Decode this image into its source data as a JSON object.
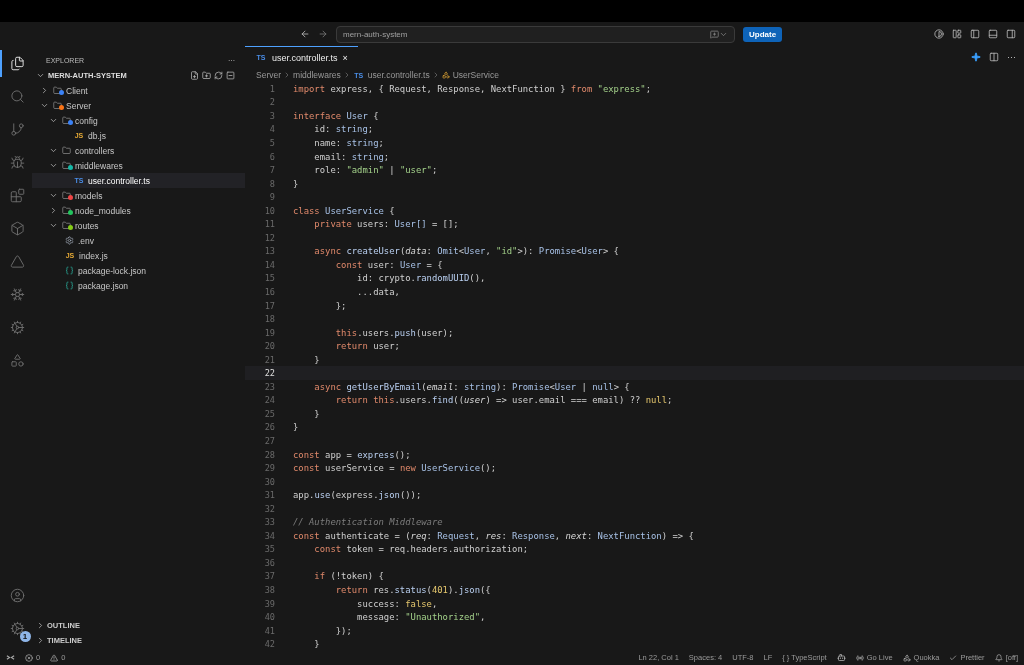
{
  "titlebar": {
    "search": {
      "value": "mern-auth-system"
    },
    "update_button": "Update"
  },
  "activity_bar": {
    "items": [
      {
        "kind": "files",
        "selected": true
      },
      {
        "kind": "search",
        "selected": false
      },
      {
        "kind": "git",
        "selected": false
      },
      {
        "kind": "debug",
        "selected": false
      },
      {
        "kind": "extensions",
        "selected": false
      },
      {
        "kind": "box",
        "selected": false
      },
      {
        "kind": "triangle",
        "selected": false
      },
      {
        "kind": "snowflake",
        "selected": false
      },
      {
        "kind": "cog",
        "selected": false
      },
      {
        "kind": "delta",
        "selected": false
      }
    ],
    "settings_badge": "1"
  },
  "sidebar": {
    "title": "EXPLORER",
    "more": "···",
    "root": {
      "label": "MERN-AUTH-SYSTEM",
      "expanded": true
    },
    "tree": [
      {
        "label": "Client",
        "kind": "folder",
        "color": "#3b82f6",
        "expanded": false,
        "selected": false
      },
      {
        "label": "Server",
        "kind": "folder",
        "color": "#f97316",
        "expanded": true,
        "selected": false,
        "children": [
          {
            "label": "config",
            "kind": "folder",
            "color": "#3b82f6",
            "expanded": true,
            "selected": false,
            "children": [
              {
                "label": "db.js",
                "kind": "js",
                "badge": "JS",
                "selected": false
              }
            ]
          },
          {
            "label": "controllers",
            "kind": "folder",
            "expanded": true,
            "selected": false
          },
          {
            "label": "middlewares",
            "kind": "folder",
            "color": "#14b8a6",
            "expanded": true,
            "selected": false,
            "children": [
              {
                "label": "user.controller.ts",
                "kind": "ts",
                "badge": "TS",
                "selected": true
              }
            ]
          },
          {
            "label": "models",
            "kind": "folder",
            "color": "#ef4444",
            "expanded": true,
            "selected": false
          },
          {
            "label": "node_modules",
            "kind": "folder",
            "color": "#22c55e",
            "expanded": false,
            "selected": false
          },
          {
            "label": "routes",
            "kind": "folder",
            "color": "#84cc16",
            "expanded": true,
            "selected": false
          },
          {
            "label": ".env",
            "kind": "env",
            "selected": false
          },
          {
            "label": "index.js",
            "kind": "js",
            "badge": "JS",
            "selected": false
          },
          {
            "label": "package-lock.json",
            "kind": "json",
            "selected": false
          },
          {
            "label": "package.json",
            "kind": "json",
            "selected": false
          }
        ]
      }
    ],
    "panels": [
      {
        "label": "OUTLINE",
        "expanded": false
      },
      {
        "label": "TIMELINE",
        "expanded": false
      }
    ]
  },
  "editor": {
    "tabs": [
      {
        "label": "user.controller.ts",
        "badge": "TS",
        "close": "×",
        "selected": true
      }
    ],
    "tab_more": "···",
    "breadcrumbs": [
      {
        "label": "Server",
        "kind": "folder"
      },
      {
        "label": "middlewares",
        "kind": "folder"
      },
      {
        "label": "user.controller.ts",
        "kind": "ts",
        "badge": "TS"
      },
      {
        "label": "UserService",
        "kind": "class"
      }
    ],
    "lines": [
      {
        "number": "1",
        "current": false,
        "tokens": [
          {
            "text": "import",
            "kind": "kw"
          },
          {
            "text": " express, { Request, Response, NextFunction } ",
            "kind": "pl"
          },
          {
            "text": "from",
            "kind": "kw"
          },
          {
            "text": " \"express\"",
            "kind": "st"
          },
          {
            "text": ";",
            "kind": "pl"
          }
        ]
      },
      {
        "number": "2",
        "current": false
      },
      {
        "number": "3",
        "current": false,
        "tokens": [
          {
            "text": "interface",
            "kind": "kw"
          },
          {
            "text": " User",
            "kind": "ty"
          },
          {
            "text": " {",
            "kind": "pl"
          }
        ]
      },
      {
        "number": "4",
        "current": false,
        "tokens": [
          {
            "text": "    id: ",
            "kind": "pl"
          },
          {
            "text": "string",
            "kind": "ty"
          },
          {
            "text": ";",
            "kind": "pl"
          }
        ]
      },
      {
        "number": "5",
        "current": false,
        "tokens": [
          {
            "text": "    name: ",
            "kind": "pl"
          },
          {
            "text": "string",
            "kind": "ty"
          },
          {
            "text": ";",
            "kind": "pl"
          }
        ]
      },
      {
        "number": "6",
        "current": false,
        "tokens": [
          {
            "text": "    email: ",
            "kind": "pl"
          },
          {
            "text": "string",
            "kind": "ty"
          },
          {
            "text": ";",
            "kind": "pl"
          }
        ]
      },
      {
        "number": "7",
        "current": false,
        "tokens": [
          {
            "text": "    role: ",
            "kind": "pl"
          },
          {
            "text": "\"admin\"",
            "kind": "st"
          },
          {
            "text": " | ",
            "kind": "pl"
          },
          {
            "text": "\"user\"",
            "kind": "st"
          },
          {
            "text": ";",
            "kind": "pl"
          }
        ]
      },
      {
        "number": "8",
        "current": false,
        "tokens": [
          {
            "text": "}",
            "kind": "pl"
          }
        ]
      },
      {
        "number": "9",
        "current": false
      },
      {
        "number": "10",
        "current": false,
        "tokens": [
          {
            "text": "class",
            "kind": "kw"
          },
          {
            "text": " UserService",
            "kind": "ty"
          },
          {
            "text": " {",
            "kind": "pl"
          }
        ]
      },
      {
        "number": "11",
        "current": false,
        "tokens": [
          {
            "text": "    private",
            "kind": "kw"
          },
          {
            "text": " users: ",
            "kind": "pl"
          },
          {
            "text": "User[]",
            "kind": "ty"
          },
          {
            "text": " = [];",
            "kind": "pl"
          }
        ]
      },
      {
        "number": "12",
        "current": false
      },
      {
        "number": "13",
        "current": false,
        "tokens": [
          {
            "text": "    async",
            "kind": "kw"
          },
          {
            "text": " createUser",
            "kind": "fn"
          },
          {
            "text": "(",
            "kind": "pl"
          },
          {
            "text": "data",
            "kind": "pa"
          },
          {
            "text": ": ",
            "kind": "pl"
          },
          {
            "text": "Omit",
            "kind": "ty"
          },
          {
            "text": "<",
            "kind": "pl"
          },
          {
            "text": "User",
            "kind": "ty"
          },
          {
            "text": ", ",
            "kind": "pl"
          },
          {
            "text": "\"id\"",
            "kind": "st"
          },
          {
            "text": ">): ",
            "kind": "pl"
          },
          {
            "text": "Promise",
            "kind": "ty"
          },
          {
            "text": "<",
            "kind": "pl"
          },
          {
            "text": "User",
            "kind": "ty"
          },
          {
            "text": "> {",
            "kind": "pl"
          }
        ]
      },
      {
        "number": "14",
        "current": false,
        "tokens": [
          {
            "text": "        const",
            "kind": "kw"
          },
          {
            "text": " user: ",
            "kind": "pl"
          },
          {
            "text": "User",
            "kind": "ty"
          },
          {
            "text": " = {",
            "kind": "pl"
          }
        ]
      },
      {
        "number": "15",
        "current": false,
        "tokens": [
          {
            "text": "            id: crypto.",
            "kind": "pl"
          },
          {
            "text": "randomUUID",
            "kind": "fn"
          },
          {
            "text": "(),",
            "kind": "pl"
          }
        ]
      },
      {
        "number": "16",
        "current": false,
        "tokens": [
          {
            "text": "            ...data,",
            "kind": "pl"
          }
        ]
      },
      {
        "number": "17",
        "current": false,
        "tokens": [
          {
            "text": "        };",
            "kind": "pl"
          }
        ]
      },
      {
        "number": "18",
        "current": false
      },
      {
        "number": "19",
        "current": false,
        "tokens": [
          {
            "text": "        this",
            "kind": "kw"
          },
          {
            "text": ".users.",
            "kind": "pl"
          },
          {
            "text": "push",
            "kind": "fn"
          },
          {
            "text": "(user);",
            "kind": "pl"
          }
        ]
      },
      {
        "number": "20",
        "current": false,
        "tokens": [
          {
            "text": "        return",
            "kind": "kw"
          },
          {
            "text": " user;",
            "kind": "pl"
          }
        ]
      },
      {
        "number": "21",
        "current": false,
        "tokens": [
          {
            "text": "    }",
            "kind": "pl"
          }
        ]
      },
      {
        "number": "22",
        "current": true
      },
      {
        "number": "23",
        "current": false,
        "tokens": [
          {
            "text": "    async",
            "kind": "kw"
          },
          {
            "text": " getUserByEmail",
            "kind": "fn"
          },
          {
            "text": "(",
            "kind": "pl"
          },
          {
            "text": "email",
            "kind": "pa"
          },
          {
            "text": ": ",
            "kind": "pl"
          },
          {
            "text": "string",
            "kind": "ty"
          },
          {
            "text": "): ",
            "kind": "pl"
          },
          {
            "text": "Promise",
            "kind": "ty"
          },
          {
            "text": "<",
            "kind": "pl"
          },
          {
            "text": "User",
            "kind": "ty"
          },
          {
            "text": " | ",
            "kind": "pl"
          },
          {
            "text": "null",
            "kind": "ty"
          },
          {
            "text": "> {",
            "kind": "pl"
          }
        ]
      },
      {
        "number": "24",
        "current": false,
        "tokens": [
          {
            "text": "        return",
            "kind": "kw"
          },
          {
            "text": " this",
            "kind": "kw"
          },
          {
            "text": ".users.",
            "kind": "pl"
          },
          {
            "text": "find",
            "kind": "fn"
          },
          {
            "text": "((",
            "kind": "pl"
          },
          {
            "text": "user",
            "kind": "pa"
          },
          {
            "text": ") => user.email === email) ?? ",
            "kind": "pl"
          },
          {
            "text": "null",
            "kind": "nu"
          },
          {
            "text": ";",
            "kind": "pl"
          }
        ]
      },
      {
        "number": "25",
        "current": false,
        "tokens": [
          {
            "text": "    }",
            "kind": "pl"
          }
        ]
      },
      {
        "number": "26",
        "current": false,
        "tokens": [
          {
            "text": "}",
            "kind": "pl"
          }
        ]
      },
      {
        "number": "27",
        "current": false
      },
      {
        "number": "28",
        "current": false,
        "tokens": [
          {
            "text": "const",
            "kind": "kw"
          },
          {
            "text": " app = ",
            "kind": "pl"
          },
          {
            "text": "express",
            "kind": "fn"
          },
          {
            "text": "();",
            "kind": "pl"
          }
        ]
      },
      {
        "number": "29",
        "current": false,
        "tokens": [
          {
            "text": "const",
            "kind": "kw"
          },
          {
            "text": " userService = ",
            "kind": "pl"
          },
          {
            "text": "new",
            "kind": "kw"
          },
          {
            "text": " UserService",
            "kind": "ty"
          },
          {
            "text": "();",
            "kind": "pl"
          }
        ]
      },
      {
        "number": "30",
        "current": false
      },
      {
        "number": "31",
        "current": false,
        "tokens": [
          {
            "text": "app.",
            "kind": "pl"
          },
          {
            "text": "use",
            "kind": "fn"
          },
          {
            "text": "(express.",
            "kind": "pl"
          },
          {
            "text": "json",
            "kind": "fn"
          },
          {
            "text": "());",
            "kind": "pl"
          }
        ]
      },
      {
        "number": "32",
        "current": false
      },
      {
        "number": "33",
        "current": false,
        "tokens": [
          {
            "text": "// Authentication Middleware",
            "kind": "cm"
          }
        ]
      },
      {
        "number": "34",
        "current": false,
        "tokens": [
          {
            "text": "const",
            "kind": "kw"
          },
          {
            "text": " authenticate = (",
            "kind": "pl"
          },
          {
            "text": "req",
            "kind": "pa"
          },
          {
            "text": ": ",
            "kind": "pl"
          },
          {
            "text": "Request",
            "kind": "ty"
          },
          {
            "text": ", ",
            "kind": "pl"
          },
          {
            "text": "res",
            "kind": "pa"
          },
          {
            "text": ": ",
            "kind": "pl"
          },
          {
            "text": "Response",
            "kind": "ty"
          },
          {
            "text": ", ",
            "kind": "pl"
          },
          {
            "text": "next",
            "kind": "pa"
          },
          {
            "text": ": ",
            "kind": "pl"
          },
          {
            "text": "NextFunction",
            "kind": "ty"
          },
          {
            "text": ") => {",
            "kind": "pl"
          }
        ]
      },
      {
        "number": "35",
        "current": false,
        "tokens": [
          {
            "text": "    const",
            "kind": "kw"
          },
          {
            "text": " token = req.headers.authorization;",
            "kind": "pl"
          }
        ]
      },
      {
        "number": "36",
        "current": false
      },
      {
        "number": "37",
        "current": false,
        "tokens": [
          {
            "text": "    if",
            "kind": "kw"
          },
          {
            "text": " (!token) {",
            "kind": "pl"
          }
        ]
      },
      {
        "number": "38",
        "current": false,
        "tokens": [
          {
            "text": "        return",
            "kind": "kw"
          },
          {
            "text": " res.",
            "kind": "pl"
          },
          {
            "text": "status",
            "kind": "fn"
          },
          {
            "text": "(",
            "kind": "pl"
          },
          {
            "text": "401",
            "kind": "nu"
          },
          {
            "text": ").",
            "kind": "pl"
          },
          {
            "text": "json",
            "kind": "fn"
          },
          {
            "text": "({",
            "kind": "pl"
          }
        ]
      },
      {
        "number": "39",
        "current": false,
        "tokens": [
          {
            "text": "            success: ",
            "kind": "pl"
          },
          {
            "text": "false",
            "kind": "nu"
          },
          {
            "text": ",",
            "kind": "pl"
          }
        ]
      },
      {
        "number": "40",
        "current": false,
        "tokens": [
          {
            "text": "            message: ",
            "kind": "pl"
          },
          {
            "text": "\"Unauthorized\"",
            "kind": "st"
          },
          {
            "text": ",",
            "kind": "pl"
          }
        ]
      },
      {
        "number": "41",
        "current": false,
        "tokens": [
          {
            "text": "        });",
            "kind": "pl"
          }
        ]
      },
      {
        "number": "42",
        "current": false,
        "tokens": [
          {
            "text": "    }",
            "kind": "pl"
          }
        ]
      }
    ]
  },
  "status_bar": {
    "errors": "0",
    "warnings": "0",
    "right": [
      {
        "label": "Ln 22, Col 1",
        "kind": "text"
      },
      {
        "label": "Spaces: 4",
        "kind": "text"
      },
      {
        "label": "UTF-8",
        "kind": "text"
      },
      {
        "label": "LF",
        "kind": "text"
      },
      {
        "label": "{ } TypeScript",
        "kind": "text"
      },
      {
        "kind": "copilot"
      },
      {
        "label": "Go Live",
        "kind": "golive"
      },
      {
        "label": "Quokka",
        "kind": "quokka"
      },
      {
        "label": "Prettier",
        "kind": "prettier"
      },
      {
        "label": "[off]",
        "kind": "off"
      }
    ]
  }
}
